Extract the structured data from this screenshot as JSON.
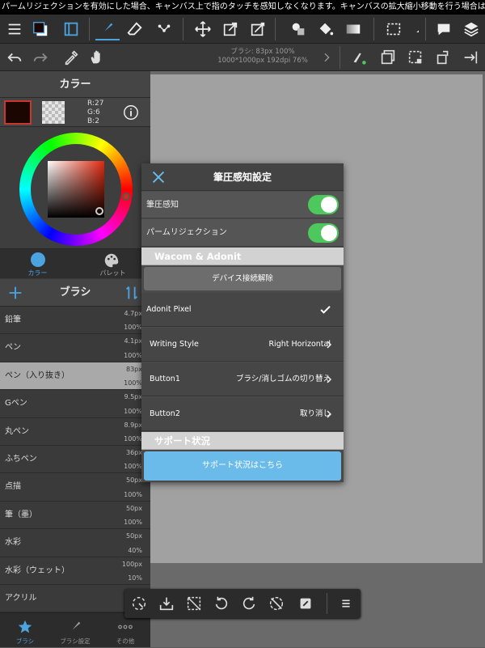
{
  "ticker": "パームリジェクションを有効にした場合、キャンバス上で指のタッチを感知しなくなります。キャンバスの拡大縮小移動を行う場合は手の…",
  "brush_info": {
    "line1": "ブラシ: 83px 100%",
    "line2": "1000*1000px 192dpi 76%"
  },
  "color_panel": {
    "title": "カラー",
    "r": "R:27",
    "g": "G:6",
    "b": "B:2",
    "main_color": "#1b0602",
    "tabs": [
      {
        "label": "カラー"
      },
      {
        "label": "パレット"
      }
    ]
  },
  "brush_panel": {
    "title": "ブラシ",
    "items": [
      {
        "name": "鉛筆",
        "size": "4.7px",
        "opacity": "100%"
      },
      {
        "name": "ペン",
        "size": "4.1px",
        "opacity": "100%"
      },
      {
        "name": "ペン（入り抜き）",
        "size": "83px",
        "opacity": "100%"
      },
      {
        "name": "Gペン",
        "size": "9.5px",
        "opacity": "100%"
      },
      {
        "name": "丸ペン",
        "size": "8.9px",
        "opacity": "100%"
      },
      {
        "name": "ふちペン",
        "size": "36px",
        "opacity": "100%"
      },
      {
        "name": "点描",
        "size": "50px",
        "opacity": "100%"
      },
      {
        "name": "筆（墨）",
        "size": "50px",
        "opacity": "100%"
      },
      {
        "name": "水彩",
        "size": "50px",
        "opacity": "40%"
      },
      {
        "name": "水彩（ウェット）",
        "size": "100px",
        "opacity": "10%"
      },
      {
        "name": "アクリル",
        "size": "",
        "opacity": ""
      }
    ],
    "selected_index": 2,
    "bottom_tabs": [
      {
        "label": "ブラシ"
      },
      {
        "label": "ブラシ設定"
      },
      {
        "label": "その他"
      }
    ]
  },
  "dialog": {
    "title": "筆圧感知設定",
    "pressure_label": "筆圧感知",
    "palm_label": "パームリジェクション",
    "section_wacom": "Wacom & Adonit",
    "disconnect_label": "デバイス接続解除",
    "device": "Adonit Pixel",
    "writing_style_key": "Writing Style",
    "writing_style_val": "Right Horizontal",
    "button1_key": "Button1",
    "button1_val": "ブラシ/消しゴムの切り替え",
    "button2_key": "Button2",
    "button2_val": "取り消し",
    "section_support": "サポート状況",
    "support_button": "サポート状況はこちら",
    "toggle_color": "#4cc85c",
    "accent_color": "#6bbbea"
  }
}
